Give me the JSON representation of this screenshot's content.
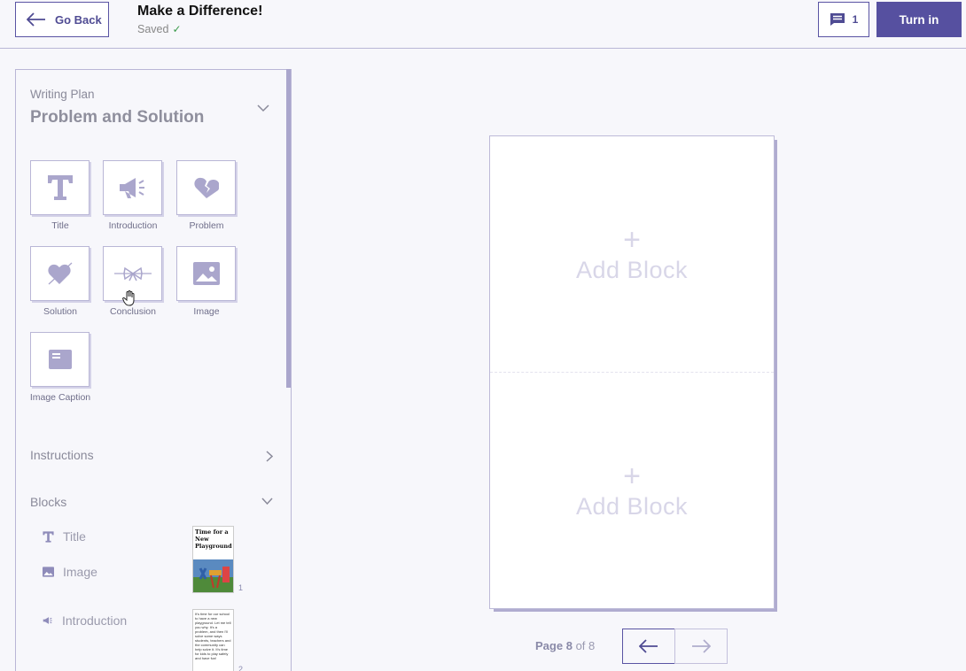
{
  "header": {
    "back_label": "Go Back",
    "title": "Make a Difference!",
    "saved_label": "Saved",
    "saved_check": "✓",
    "comment_count": "1",
    "turn_in_label": "Turn in"
  },
  "sidebar": {
    "writing_plan_label": "Writing Plan",
    "writing_plan_title": "Problem and Solution",
    "tiles": [
      {
        "label": "Title",
        "icon": "title-T-icon"
      },
      {
        "label": "Introduction",
        "icon": "megaphone-icon"
      },
      {
        "label": "Problem",
        "icon": "broken-heart-icon"
      },
      {
        "label": "Solution",
        "icon": "mended-heart-icon"
      },
      {
        "label": "Conclusion",
        "icon": "ribbon-icon"
      },
      {
        "label": "Image",
        "icon": "image-icon"
      },
      {
        "label": "Image Caption",
        "icon": "caption-icon"
      }
    ],
    "instructions_label": "Instructions",
    "blocks_label": "Blocks",
    "blocks": [
      {
        "label": "Title",
        "icon": "title-T-icon"
      },
      {
        "label": "Image",
        "icon": "image-icon"
      },
      {
        "label": "Introduction",
        "icon": "megaphone-icon"
      }
    ],
    "thumbs": [
      {
        "heading": "Time for a New Playground",
        "page": "1"
      },
      {
        "text": "It's time for our school to have a new playground. Let me tell you why. It's a problem, and then I'll solve some ways students, teachers and the community can help solve it. It's time for kids to play safely and have fun!",
        "page": "2"
      }
    ]
  },
  "canvas": {
    "add_block_plus": "+",
    "add_block_label": "Add Block",
    "page_word": "Page",
    "page_current": "8",
    "page_of": "of 8"
  },
  "colors": {
    "accent": "#5650a0",
    "border": "#b9b6d6",
    "background": "#f7f7fb"
  }
}
